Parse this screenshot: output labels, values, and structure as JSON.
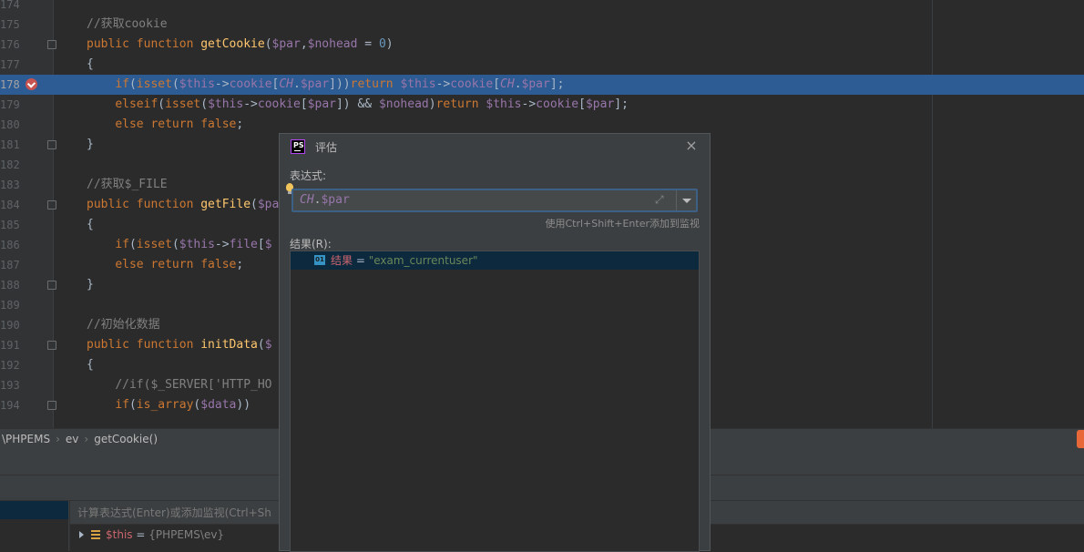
{
  "editor": {
    "lines": [
      {
        "num": "174",
        "html": ""
      },
      {
        "num": "175",
        "html": "<span class=\"c\">//获取cookie</span>"
      },
      {
        "num": "176",
        "html": "<span class=\"k\">public function </span><span class=\"f\">getCookie</span>(<span class=\"v\">$par</span>,<span class=\"v\">$nohead</span> = <span class=\"n\">0</span>)"
      },
      {
        "num": "177",
        "html": "{"
      },
      {
        "num": "178",
        "html": "    <span class=\"k\">if</span>(<span class=\"k\">isset</span>(<span class=\"v\">$this</span>-&gt;<span class=\"v\">cookie</span>[<span class=\"i\">CH</span>.<span class=\"v\">$par</span>]))<span class=\"k\">return </span><span class=\"v\">$this</span>-&gt;<span class=\"v\">cookie</span>[<span class=\"i\">CH</span>.<span class=\"v\">$par</span>];"
      },
      {
        "num": "179",
        "html": "    <span class=\"k\">elseif</span>(<span class=\"k\">isset</span>(<span class=\"v\">$this</span>-&gt;<span class=\"v\">cookie</span>[<span class=\"v\">$par</span>]) &amp;&amp; <span class=\"v\">$nohead</span>)<span class=\"k\">return </span><span class=\"v\">$this</span>-&gt;<span class=\"v\">cookie</span>[<span class=\"v\">$par</span>];"
      },
      {
        "num": "180",
        "html": "    <span class=\"k\">else return false</span>;"
      },
      {
        "num": "181",
        "html": "}"
      },
      {
        "num": "182",
        "html": ""
      },
      {
        "num": "183",
        "html": "<span class=\"c\">//获取$_FILE</span>"
      },
      {
        "num": "184",
        "html": "<span class=\"k\">public function </span><span class=\"f\">getFile</span>(<span class=\"v\">$pa</span>"
      },
      {
        "num": "185",
        "html": "{"
      },
      {
        "num": "186",
        "html": "    <span class=\"k\">if</span>(<span class=\"k\">isset</span>(<span class=\"v\">$this</span>-&gt;<span class=\"v\">file</span>[<span class=\"v\">$</span>"
      },
      {
        "num": "187",
        "html": "    <span class=\"k\">else return false</span>;"
      },
      {
        "num": "188",
        "html": "}"
      },
      {
        "num": "189",
        "html": ""
      },
      {
        "num": "190",
        "html": "<span class=\"c\">//初始化数据</span>"
      },
      {
        "num": "191",
        "html": "<span class=\"k\">public function </span><span class=\"f\">initData</span>(<span class=\"v\">$</span>"
      },
      {
        "num": "192",
        "html": "{"
      },
      {
        "num": "193",
        "html": "    <span class=\"c\">//if($_SERVER['HTTP_HO</span>"
      },
      {
        "num": "194",
        "html": "    <span class=\"k\">if</span>(<span class=\"k\">is_array</span>(<span class=\"v\">$data</span>))"
      }
    ]
  },
  "breadcrumb": {
    "items": [
      "\\PHPEMS",
      "ev",
      "getCookie()"
    ]
  },
  "variables": {
    "input_placeholder": "计算表达式(Enter)或添加监视(Ctrl+Sh",
    "row_name": "$this",
    "row_eq": " = ",
    "row_value": "{PHPEMS\\ev}"
  },
  "dialog": {
    "title": "评估",
    "expression_label": "表达式:",
    "expression_value": "CH.$par",
    "hint": "使用Ctrl+Shift+Enter添加到监视",
    "result_label": "结果(R):",
    "result_name": "结果",
    "result_eq": " = ",
    "result_value": "\"exam_currentuser\"",
    "close_glyph": "×",
    "expand_glyph": "⤢",
    "logo_text": "PS"
  },
  "colors": {
    "accent": "#2d5b93",
    "breakpoint": "#c75450",
    "selection": "#0d293e"
  }
}
